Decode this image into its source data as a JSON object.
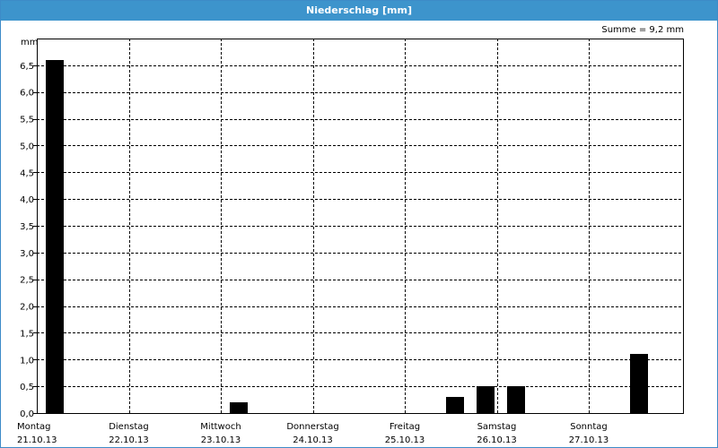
{
  "title": "Niederschlag [mm]",
  "sum_label": "Summe = 9,2 mm",
  "colors": {
    "header": "#3d94cc",
    "bar": "#000000",
    "grid": "#000000",
    "background": "#ffffff"
  },
  "chart_data": {
    "type": "bar",
    "title": "Niederschlag [mm]",
    "ylabel": "mm",
    "xlabel": "",
    "ylim": [
      0,
      7
    ],
    "xlim": [
      0,
      7
    ],
    "yticks": [
      0,
      0.5,
      1.0,
      1.5,
      2.0,
      2.5,
      3.0,
      3.5,
      4.0,
      4.5,
      5.0,
      5.5,
      6.0,
      6.5
    ],
    "ytick_labels": [
      "0,0",
      "0,5",
      "1,0",
      "1,5",
      "2,0",
      "2,5",
      "3,0",
      "3,5",
      "4,0",
      "4,5",
      "5,0",
      "5,5",
      "6,0",
      "6,5"
    ],
    "grid": true,
    "x_ticks": [
      {
        "day": "Montag",
        "date": "21.10.13"
      },
      {
        "day": "Dienstag",
        "date": "22.10.13"
      },
      {
        "day": "Mittwoch",
        "date": "23.10.13"
      },
      {
        "day": "Donnerstag",
        "date": "24.10.13"
      },
      {
        "day": "Freitag",
        "date": "25.10.13"
      },
      {
        "day": "Samstag",
        "date": "26.10.13"
      },
      {
        "day": "Sonntag",
        "date": "27.10.13"
      }
    ],
    "series": [
      {
        "points": [
          {
            "x": 0.1,
            "value": 6.6
          },
          {
            "x": 2.1,
            "value": 0.2
          },
          {
            "x": 4.45,
            "value": 0.3
          },
          {
            "x": 4.78,
            "value": 0.5
          },
          {
            "x": 5.11,
            "value": 0.5
          },
          {
            "x": 6.45,
            "value": 1.1
          }
        ]
      }
    ]
  }
}
